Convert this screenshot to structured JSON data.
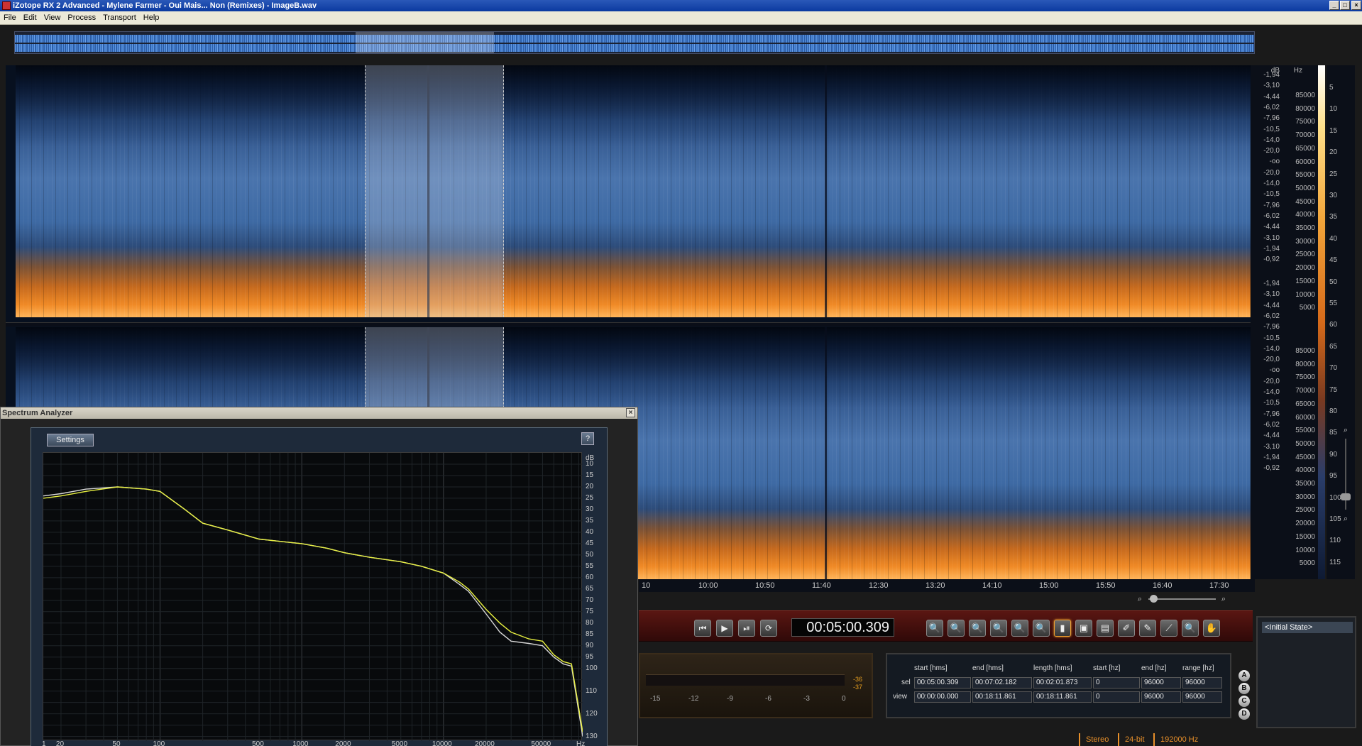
{
  "window": {
    "title": "iZotope RX 2 Advanced - Mylene Farmer - Oui Mais... Non (Remixes) - ImageB.wav",
    "min": "_",
    "max": "□",
    "close": "×"
  },
  "menu": [
    {
      "label": "File"
    },
    {
      "label": "Edit"
    },
    {
      "label": "View"
    },
    {
      "label": "Process"
    },
    {
      "label": "Transport"
    },
    {
      "label": "Help"
    }
  ],
  "spectrogram": {
    "db_unit": "dB",
    "hz_unit": "Hz",
    "db_ticks_top": [
      "-1,94",
      "-3,10",
      "-4,44",
      "-6,02",
      "-7,96",
      "-10,5",
      "-14,0",
      "-20,0",
      "-oo",
      "-20,0",
      "-14,0",
      "-10,5",
      "-7,96",
      "-6,02",
      "-4,44",
      "-3,10",
      "-1,94",
      "-0,92"
    ],
    "db_ticks_bottom": [
      "-1,94",
      "-3,10",
      "-4,44",
      "-6,02",
      "-7,96",
      "-10,5",
      "-14,0",
      "-20,0",
      "-oo",
      "-20,0",
      "-14,0",
      "-10,5",
      "-7,96",
      "-6,02",
      "-4,44",
      "-3,10",
      "-1,94",
      "-0,92"
    ],
    "hz_ticks_top": [
      "85000",
      "80000",
      "75000",
      "70000",
      "65000",
      "60000",
      "55000",
      "50000",
      "45000",
      "40000",
      "35000",
      "30000",
      "25000",
      "20000",
      "15000",
      "10000",
      "5000"
    ],
    "hz_ticks_bottom": [
      "85000",
      "80000",
      "75000",
      "70000",
      "65000",
      "60000",
      "55000",
      "50000",
      "45000",
      "40000",
      "35000",
      "30000",
      "25000",
      "20000",
      "15000",
      "10000",
      "5000"
    ],
    "colorbar_ticks": [
      "5",
      "10",
      "15",
      "20",
      "25",
      "30",
      "35",
      "40",
      "45",
      "50",
      "55",
      "60",
      "65",
      "70",
      "75",
      "80",
      "85",
      "90",
      "95",
      "100",
      "105",
      "110",
      "115"
    ]
  },
  "time_ruler": [
    "10",
    "10:00",
    "10:50",
    "11:40",
    "12:30",
    "13:20",
    "14:10",
    "15:00",
    "15:50",
    "16:40",
    "17:30"
  ],
  "transport": {
    "timecode": "00:05:00.309",
    "buttons": [
      "⏮",
      "▶",
      "⏯",
      "⟳"
    ],
    "tools": [
      "🔍",
      "🔍",
      "🔍",
      "🔍",
      "🔍",
      "🔍",
      "▮",
      "▣",
      "▤",
      "✐",
      "✎",
      "⟋",
      "🔍",
      "✋"
    ]
  },
  "meter": {
    "scale": [
      "-15",
      "-12",
      "-9",
      "-6",
      "-3",
      "0"
    ],
    "peak_top": "-36",
    "peak_bottom": "-37"
  },
  "selection": {
    "headers": [
      "start [hms]",
      "end [hms]",
      "length [hms]",
      "start [hz]",
      "end [hz]",
      "range [hz]"
    ],
    "rows": [
      {
        "label": "sel",
        "values": [
          "00:05:00.309",
          "00:07:02.182",
          "00:02:01.873",
          "0",
          "96000",
          "96000"
        ]
      },
      {
        "label": "view",
        "values": [
          "00:00:00.000",
          "00:18:11.861",
          "00:18:11.861",
          "0",
          "96000",
          "96000"
        ]
      }
    ]
  },
  "compare_buttons": [
    "A",
    "B",
    "C",
    "D"
  ],
  "history": {
    "items": [
      "<Initial State>"
    ]
  },
  "status": {
    "channels": "Stereo",
    "bitdepth": "24-bit",
    "samplerate": "192000 Hz"
  },
  "analyzer": {
    "title": "Spectrum Analyzer",
    "settings_label": "Settings",
    "help_label": "?",
    "close_label": "×",
    "db_unit": "dB",
    "db_ticks": [
      "10",
      "15",
      "20",
      "25",
      "30",
      "35",
      "40",
      "45",
      "50",
      "55",
      "60",
      "65",
      "70",
      "75",
      "80",
      "85",
      "90",
      "95",
      "100",
      "110",
      "120",
      "130"
    ],
    "hz_ticks": [
      "1",
      "20",
      "50",
      "100",
      "500",
      "1000",
      "2000",
      "5000",
      "10000",
      "20000",
      "50000",
      "Hz"
    ]
  },
  "chart_data": {
    "type": "line",
    "xscale": "log",
    "xlabel": "Hz",
    "ylabel": "dB",
    "xlim": [
      15,
      96000
    ],
    "ylim": [
      -132,
      -5
    ],
    "series": [
      {
        "color": "#e8f040",
        "x": [
          15,
          20,
          30,
          50,
          80,
          100,
          150,
          200,
          300,
          500,
          700,
          1000,
          1500,
          2000,
          3000,
          5000,
          7000,
          10000,
          13000,
          15000,
          20000,
          25000,
          30000,
          40000,
          50000,
          60000,
          70000,
          80000,
          96000
        ],
        "y": [
          -25,
          -24,
          -22,
          -20,
          -21,
          -22,
          -30,
          -36,
          -39,
          -43,
          -44,
          -45,
          -47,
          -49,
          -51,
          -53,
          -55,
          -58,
          -62,
          -65,
          -74,
          -80,
          -84,
          -87,
          -88,
          -94,
          -97,
          -98,
          -128
        ]
      },
      {
        "color": "#d8d8d8",
        "x": [
          15,
          20,
          30,
          50,
          80,
          100,
          150,
          200,
          300,
          500,
          700,
          1000,
          1500,
          2000,
          3000,
          5000,
          7000,
          10000,
          13000,
          15000,
          20000,
          25000,
          30000,
          40000,
          50000,
          60000,
          70000,
          80000,
          96000
        ],
        "y": [
          -24,
          -23,
          -21,
          -20,
          -21,
          -22,
          -30,
          -36,
          -39,
          -43,
          -44,
          -45,
          -47,
          -49,
          -51,
          -53,
          -55,
          -58,
          -63,
          -66,
          -76,
          -84,
          -88,
          -89,
          -90,
          -95,
          -98,
          -99,
          -130
        ]
      }
    ]
  }
}
